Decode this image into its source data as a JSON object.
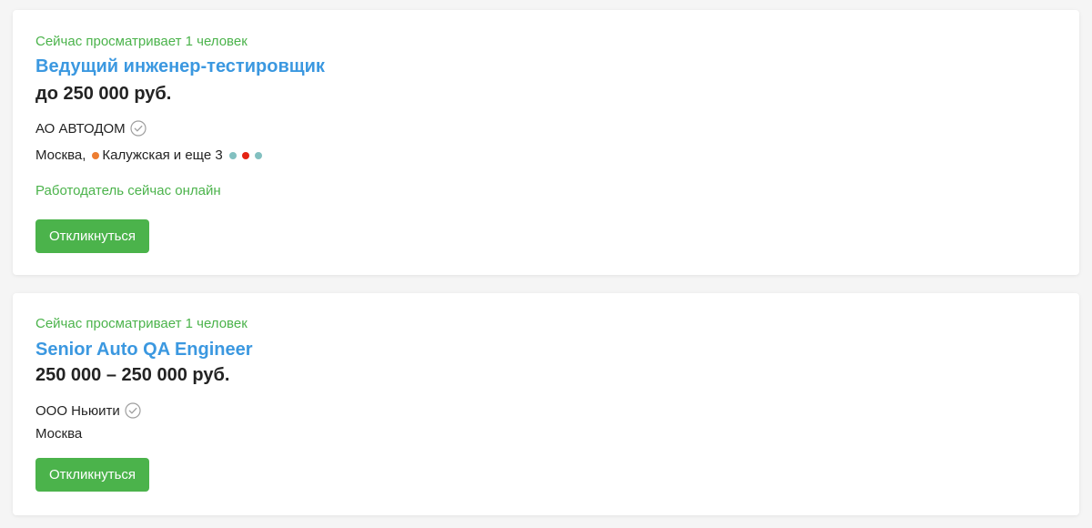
{
  "vacancies": [
    {
      "viewers": "Сейчас просматривает 1 человек",
      "title": "Ведущий инженер-тестировщик",
      "salary": "до 250 000 руб.",
      "company": "АО АВТОДОМ",
      "location": "Москва,",
      "metro": "Калужская",
      "metro_more": "и еще 3",
      "metro_colors": [
        "#ed7d31",
        "#82c0c0",
        "#e42313",
        "#82c0c0"
      ],
      "online_status": "Работодатель сейчас онлайн",
      "respond_label": "Откликнуться"
    },
    {
      "viewers": "Сейчас просматривает 1 человек",
      "title": "Senior Auto QA Engineer",
      "salary": "250 000 – 250 000 руб.",
      "company": "ООО Ньюити",
      "location": "Москва",
      "respond_label": "Откликнуться"
    }
  ],
  "colors": {
    "accent_green": "#4bb34b",
    "link_blue": "#3b98e0",
    "text": "#232323",
    "verified_icon": "#9e9e9e"
  },
  "icons": {
    "verified": "check-circle-icon",
    "metro": "metro-dot-icon"
  }
}
